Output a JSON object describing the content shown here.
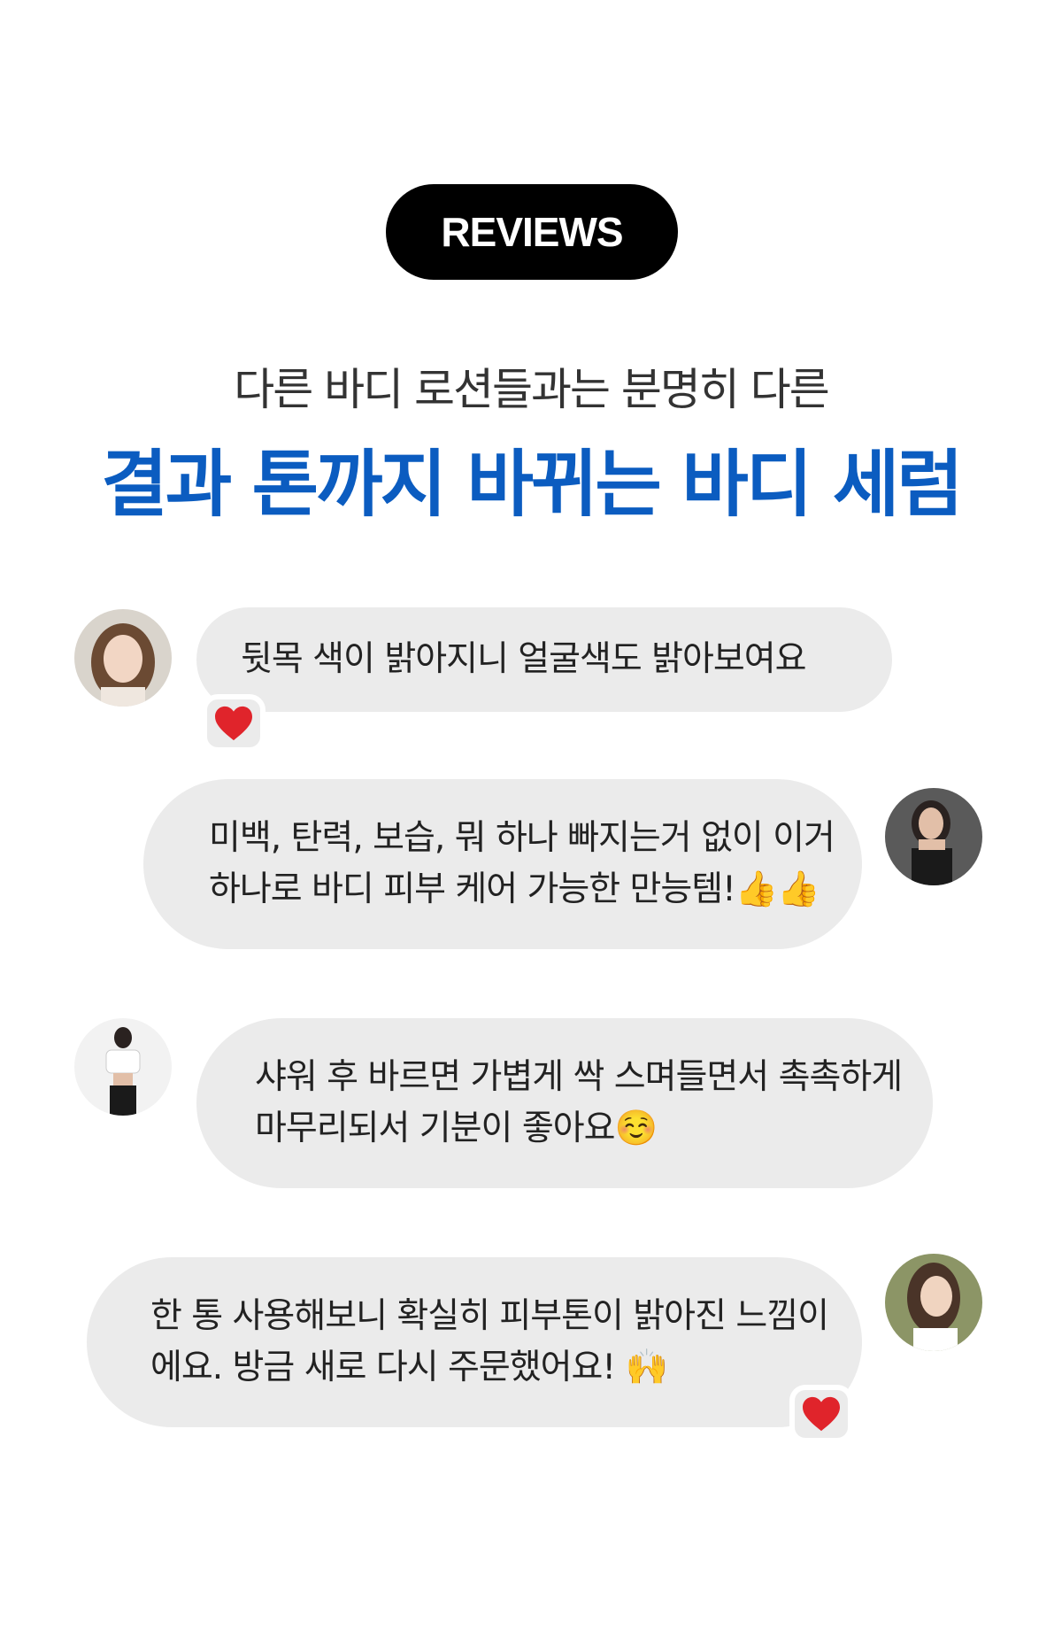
{
  "badge": {
    "label": "REVIEWS"
  },
  "subtitle": "다른 바디 로션들과는 분명히 다른",
  "headline": "결과 톤까지 바뀌는 바디 세럼",
  "reviews": [
    {
      "text": "뒷목 색이 밝아지니 얼굴색도 밝아보여요",
      "reaction": "heart"
    },
    {
      "text": "미백, 탄력, 보습, 뭐 하나 빠지는거 없이 이거\n하나로 바디 피부 케어 가능한 만능템!👍👍",
      "reaction": ""
    },
    {
      "text": "샤워 후 바르면 가볍게 싹 스며들면서 촉촉하게\n마무리되서 기분이 좋아요☺️",
      "reaction": ""
    },
    {
      "text": "한 통 사용해보니 확실히 피부톤이 밝아진 느낌이\n에요. 방금 새로 다시 주문했어요! 🙌",
      "reaction": "heart"
    }
  ],
  "colors": {
    "headline": "#0b5cc0",
    "bubble": "#ebebeb",
    "heart": "#e0242b"
  },
  "icons": [
    "heart-icon",
    "avatar"
  ]
}
